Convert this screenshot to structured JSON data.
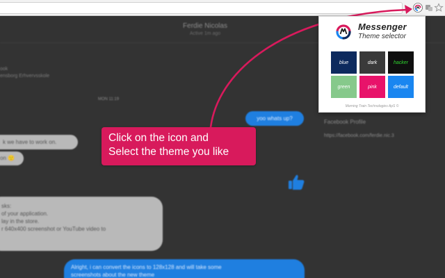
{
  "browser": {
    "icons": [
      "messenger-theme-extension-icon",
      "extensions-icon",
      "star-icon"
    ]
  },
  "messenger": {
    "contact_name": "Ferdie Nicolas",
    "contact_status": "Active 1m ago",
    "left_fragment_1": "ook",
    "left_fragment_2": "ensborg Erhvervsskole",
    "timestamp": "MON 11:19",
    "messages": [
      {
        "direction": "outgoing",
        "text": "yoo whats up?"
      },
      {
        "direction": "incoming",
        "text": "k we have to work on."
      },
      {
        "direction": "incoming",
        "text": "on 🙂"
      },
      {
        "direction": "incoming",
        "lines": [
          "sks:",
          "of your application.",
          "lay in the store.",
          "r 640x400 screenshot or YouTube video to"
        ]
      },
      {
        "direction": "outgoing",
        "lines": [
          "Alright, i can convert the icons to 128x128 and will take some",
          "screenshots about the new theme"
        ]
      }
    ],
    "right_panel": {
      "facebook_profile_label": "Facebook Profile",
      "facebook_url": "https://facebook.com/ferdie.nic.3"
    }
  },
  "annotation": {
    "callout_line1": "Click on the icon and",
    "callout_line2": "Select the theme you like",
    "color": "#d81a5c"
  },
  "popup": {
    "title": "Messenger",
    "subtitle": "Theme selector",
    "themes": [
      {
        "label": "blue",
        "bg": "#0d2a5e",
        "fg": "#ffffff"
      },
      {
        "label": "dark",
        "bg": "#3a3a3a",
        "fg": "#ffffff"
      },
      {
        "label": "hacker",
        "bg": "#0f0f0f",
        "fg": "#2fd82f"
      },
      {
        "label": "green",
        "bg": "#86c98b",
        "fg": "#ffffff"
      },
      {
        "label": "pink",
        "bg": "#e8136a",
        "fg": "#ffffff"
      },
      {
        "label": "default",
        "bg": "#1a86f0",
        "fg": "#ffffff"
      }
    ],
    "footer": "Morning Train Technologies ApS ©"
  }
}
